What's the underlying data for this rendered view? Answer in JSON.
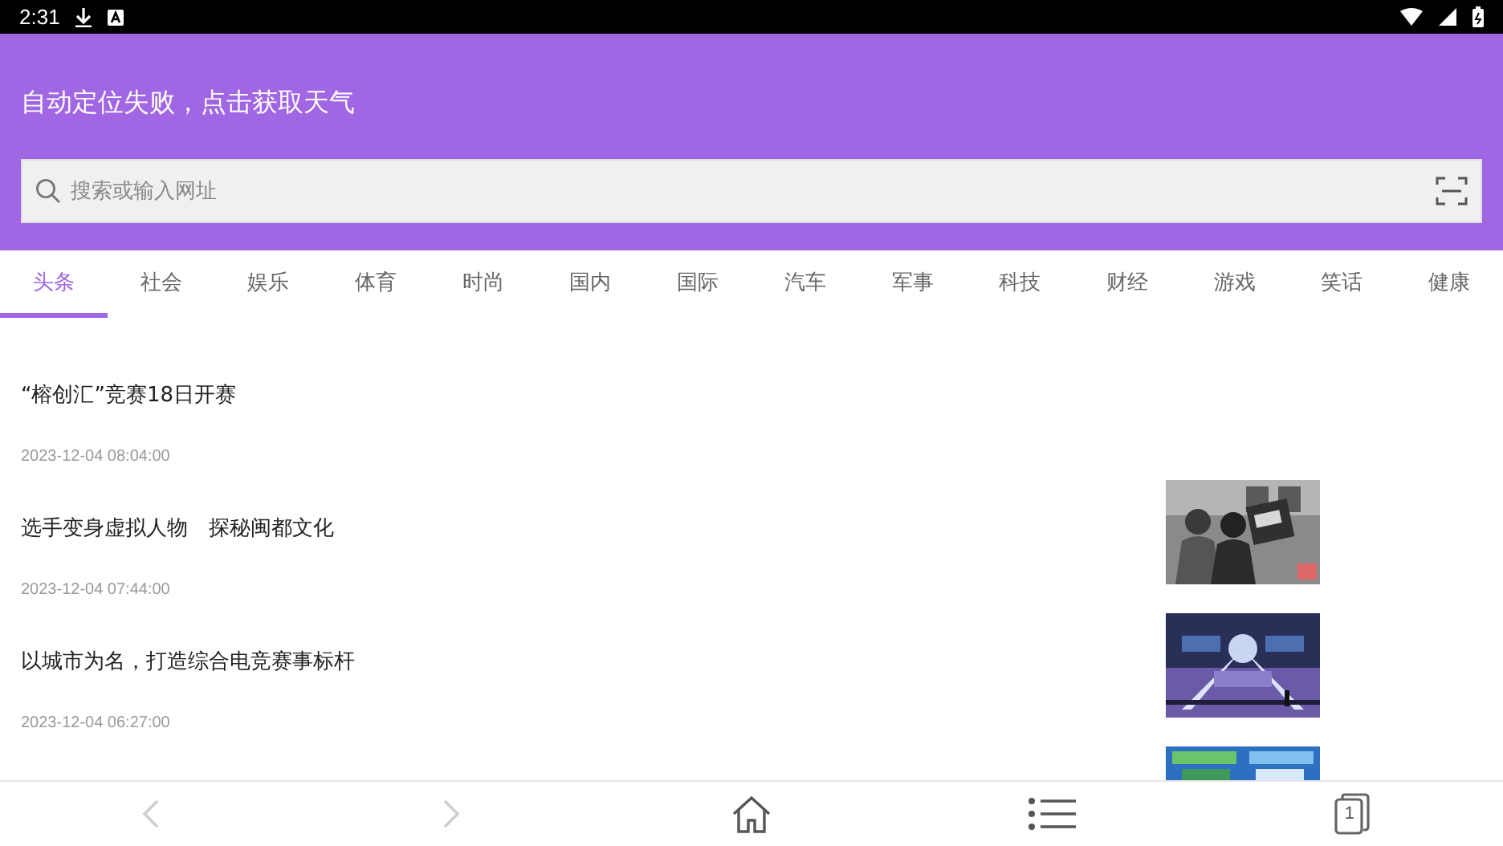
{
  "status_bar": {
    "time": "2:31"
  },
  "header": {
    "weather_prompt": "自动定位失败，点击获取天气",
    "search": {
      "placeholder": "搜索或输入网址"
    }
  },
  "tabs": [
    {
      "label": "头条",
      "selected": true
    },
    {
      "label": "社会",
      "selected": false
    },
    {
      "label": "娱乐",
      "selected": false
    },
    {
      "label": "体育",
      "selected": false
    },
    {
      "label": "时尚",
      "selected": false
    },
    {
      "label": "国内",
      "selected": false
    },
    {
      "label": "国际",
      "selected": false
    },
    {
      "label": "汽车",
      "selected": false
    },
    {
      "label": "军事",
      "selected": false
    },
    {
      "label": "科技",
      "selected": false
    },
    {
      "label": "财经",
      "selected": false
    },
    {
      "label": "游戏",
      "selected": false
    },
    {
      "label": "笑话",
      "selected": false
    },
    {
      "label": "健康",
      "selected": false
    }
  ],
  "news": [
    {
      "title": "“榕创汇”竞赛18日开赛",
      "time": "2023-12-04 08:04:00"
    },
    {
      "title": "选手变身虚拟人物　探秘闽都文化",
      "time": "2023-12-04 07:44:00",
      "image": {
        "kind": "picture"
      }
    },
    {
      "title": "以城市为名，打造综合电竞赛事标杆",
      "time": "2023-12-04 06:27:00",
      "image": {
        "kind": "picture"
      }
    },
    {
      "image": {
        "kind": "picture"
      }
    }
  ],
  "bottom_nav": {
    "back": {
      "disabled": true
    },
    "forward": {
      "disabled": true
    },
    "tab_count": "1"
  }
}
